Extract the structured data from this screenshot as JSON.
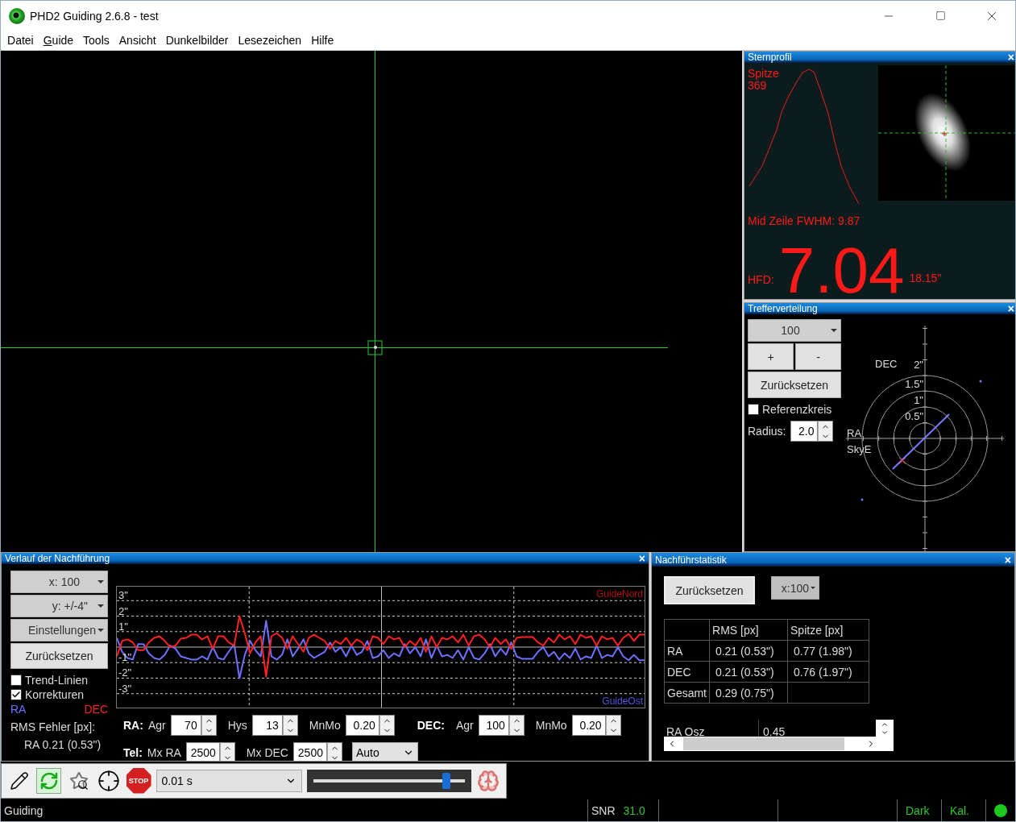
{
  "window": {
    "title": "PHD2 Guiding 2.6.8 - test"
  },
  "menu": [
    {
      "label": "Datei",
      "underlined": false
    },
    {
      "label": "Guide",
      "underlined": true
    },
    {
      "label": "Tools",
      "underlined": false
    },
    {
      "label": "Ansicht",
      "underlined": false
    },
    {
      "label": "Dunkelbilder",
      "underlined": false
    },
    {
      "label": "Lesezeichen",
      "underlined": false
    },
    {
      "label": "Hilfe",
      "underlined": false
    }
  ],
  "star_profile": {
    "title": "Sternprofil",
    "close": "×",
    "peak_label": "Spitze",
    "peak_value": "369",
    "fwhm": "Mid Zeile FWHM: 9.87",
    "hfd_label": "HFD:",
    "hfd_value": "7.04",
    "hfd_arcsec": "18.15\""
  },
  "target": {
    "title": "Trefferverteilung",
    "close": "×",
    "history_select": "100",
    "plus": "+",
    "minus": "-",
    "reset": "Zurücksetzen",
    "reference_circle": {
      "label": "Referenzkreis",
      "checked": false
    },
    "radius": {
      "label": "Radius:",
      "value": "2.0"
    },
    "ring_labels": [
      "2\"",
      "1.5\"",
      "1\"",
      "0.5\""
    ],
    "axis_labels": [
      "DEC",
      "RA",
      "SkyE"
    ]
  },
  "history": {
    "title": "Verlauf der Nachführung",
    "close": "×",
    "x_select": "x: 100",
    "y_select": "y: +/-4\"",
    "settings": "Einstellungen",
    "reset": "Zurücksetzen",
    "trend_lines": {
      "label": "Trend-Linien",
      "checked": false
    },
    "corrections": {
      "label": "Korrekturen",
      "checked": true
    },
    "rms_title": "RMS Fehler [px]:",
    "rms_ra": "RA 0.21 (0.53\")",
    "legend_top": "GuideNord",
    "legend_bottom": "GuideOst",
    "chart_data": {
      "type": "line",
      "grid": true,
      "ylim": [
        -3.9,
        3.9
      ],
      "yticks": [
        {
          "value": 3,
          "label": "3\""
        },
        {
          "value": 2,
          "label": "2\""
        },
        {
          "value": 1,
          "label": "1\""
        },
        {
          "value": -1,
          "label": "-1\""
        },
        {
          "value": -2,
          "label": "-2\""
        },
        {
          "value": -3,
          "label": "-3\""
        }
      ],
      "series": [
        {
          "name": "RA",
          "color": "#7070ff",
          "values": [
            0.6,
            -0.3,
            -0.7,
            -0.8,
            0.2,
            0.2,
            -0.4,
            -0.7,
            -0.8,
            -0.5,
            0.1,
            -0.1,
            -0.6,
            -0.7,
            -0.8,
            -0.8,
            -0.6,
            -0.8,
            0.0,
            -0.7,
            -0.8,
            -0.3,
            0.2,
            -2.0,
            -0.5,
            0.4,
            -0.2,
            -0.6,
            1.7,
            -0.6,
            -0.8,
            -0.5,
            0.5,
            -0.6,
            -0.1,
            0.5,
            -0.4,
            -0.7,
            -0.5,
            -0.3,
            0.3,
            -0.3,
            0.0,
            -0.6,
            0.1,
            -0.5,
            -0.3,
            0.4,
            -0.7,
            -0.6,
            -0.2,
            -0.7,
            -0.4,
            -0.6,
            0.2,
            -0.4,
            0.0,
            -0.6,
            0.5,
            -0.7,
            0.1,
            -0.6,
            -0.5,
            -0.7,
            -0.2,
            -0.8,
            0.0,
            -0.7,
            -0.8,
            -0.4,
            0.2,
            -0.6,
            -0.1,
            -0.5,
            0.3,
            -0.6,
            -0.75,
            -0.75,
            -0.75,
            -0.3,
            0.0,
            -0.6,
            -0.3,
            -0.8,
            -0.4,
            -0.7,
            -0.1,
            -0.8,
            -0.6,
            -0.7,
            0.1,
            -0.7,
            -0.5,
            -0.6,
            0.0,
            -0.6,
            -0.85,
            -0.5,
            -0.85,
            -0.85
          ]
        },
        {
          "name": "DEC",
          "color": "#ff2020",
          "values": [
            -0.6,
            0.4,
            0.5,
            0.3,
            -0.2,
            -0.2,
            0.3,
            0.6,
            0.7,
            0.4,
            0.0,
            0.1,
            0.55,
            0.6,
            0.8,
            0.8,
            0.5,
            0.7,
            -0.1,
            0.7,
            0.7,
            0.3,
            0.1,
            2.0,
            0.9,
            -0.4,
            0.3,
            0.7,
            -1.9,
            0.7,
            0.9,
            0.6,
            -0.1,
            0.7,
            0.2,
            -0.3,
            0.6,
            0.8,
            0.6,
            0.4,
            -0.1,
            0.4,
            0.2,
            0.6,
            0.1,
            0.5,
            0.3,
            -0.2,
            0.7,
            0.6,
            0.2,
            0.7,
            0.5,
            0.6,
            0.0,
            0.4,
            0.1,
            0.6,
            -0.3,
            0.7,
            0.0,
            0.6,
            0.5,
            0.7,
            0.3,
            0.8,
            0.1,
            0.7,
            0.8,
            0.5,
            0.0,
            0.6,
            0.2,
            0.5,
            -0.1,
            0.6,
            0.65,
            0.65,
            0.65,
            0.3,
            0.1,
            0.6,
            0.3,
            0.8,
            0.5,
            0.7,
            0.2,
            0.8,
            0.6,
            0.7,
            0.1,
            0.7,
            0.5,
            0.6,
            0.1,
            0.6,
            0.85,
            0.4,
            0.8,
            0.8
          ]
        }
      ]
    },
    "controls": [
      [
        {
          "kind": "heading",
          "text": "RA:"
        },
        {
          "kind": "spin",
          "label": "Agr",
          "value": "70"
        },
        {
          "kind": "spin",
          "label": "Hys",
          "value": "13"
        },
        {
          "kind": "spin",
          "label": "MnMo",
          "value": "0.20"
        },
        {
          "kind": "heading",
          "text": "DEC:"
        },
        {
          "kind": "spin",
          "label": "Agr",
          "value": "100"
        },
        {
          "kind": "spin",
          "label": "MnMo",
          "value": "0.20"
        }
      ],
      [
        {
          "kind": "heading",
          "text": "Tel:"
        },
        {
          "kind": "spin",
          "label": "Mx RA",
          "value": "2500"
        },
        {
          "kind": "spin",
          "label": "Mx DEC",
          "value": "2500"
        },
        {
          "kind": "select",
          "value": "Auto"
        }
      ]
    ]
  },
  "stats": {
    "title": "Nachführstatistik",
    "close": "×",
    "reset": "Zurücksetzen",
    "x_select": "x:100",
    "table": {
      "columns": [
        "RMS [px]",
        "Spitze [px]"
      ],
      "rows": [
        {
          "label": "RA",
          "cells": [
            "0.21 (0.53\")",
            "0.77 (1.98\")"
          ]
        },
        {
          "label": "DEC",
          "cells": [
            "0.21 (0.53\")",
            "0.76 (1.97\")"
          ]
        },
        {
          "label": "Gesamt",
          "cells": [
            "0.29 (0.75\")"
          ]
        }
      ]
    },
    "osc": {
      "label": "RA Osz",
      "value": "0.45"
    }
  },
  "toolbar": {
    "exposure": "0.01 s",
    "gain": {
      "level": 0.88
    },
    "stop_label": "STOP"
  },
  "status_bar": {
    "text": "Guiding",
    "snr_label": "SNR",
    "snr_value": "31.0",
    "dark": {
      "label": "Dark",
      "on": true
    },
    "calibration": {
      "label": "Kal.",
      "on": true
    },
    "connected": true
  }
}
